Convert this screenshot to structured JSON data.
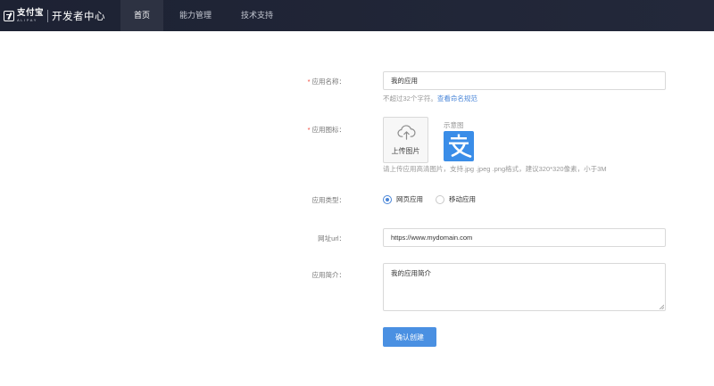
{
  "header": {
    "logo_cn": "支付宝",
    "logo_en": "ALIPAY",
    "site_title": "开发者中心",
    "nav": [
      {
        "label": "首页",
        "active": true
      },
      {
        "label": "能力管理",
        "active": false
      },
      {
        "label": "技术支持",
        "active": false
      }
    ]
  },
  "form": {
    "app_name": {
      "label": "应用名称：",
      "required": "*",
      "value": "我的应用",
      "help": "不超过32个字符。",
      "help_link": "查看命名规范"
    },
    "app_icon": {
      "label": "应用图标：",
      "required": "*",
      "upload_label": "上传图片",
      "sample_label": "示意图",
      "help": "请上传应用高清图片，支持.jpg .jpeg .png格式，建议320*320像素，小于3M"
    },
    "app_type": {
      "label": "应用类型：",
      "options": [
        {
          "label": "网页应用",
          "checked": true
        },
        {
          "label": "移动应用",
          "checked": false
        }
      ]
    },
    "url": {
      "label": "网址url：",
      "value": "https://www.mydomain.com"
    },
    "intro": {
      "label": "应用简介：",
      "value": "我的应用简介"
    },
    "submit_label": "确认创建"
  },
  "colors": {
    "topbar": "#1d2233",
    "primary": "#4a90e2",
    "link": "#4a86d8",
    "required": "#f04134",
    "sample_icon_bg": "#3a8de8"
  },
  "icons": {
    "upload": "cloud-upload-icon",
    "sample": "alipay-logo-icon",
    "logo": "alipay-logo-icon"
  }
}
